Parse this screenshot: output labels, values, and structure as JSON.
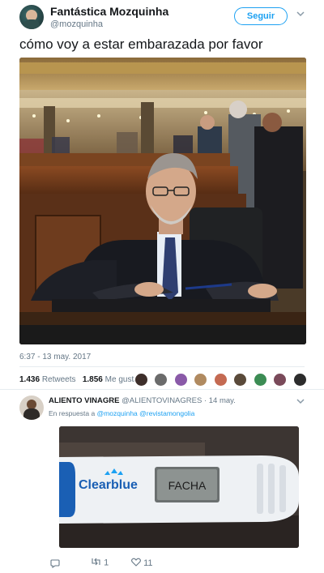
{
  "tweet": {
    "author_name": "Fantástica Mozquinha",
    "author_handle": "@mozquinha",
    "follow_label": "Seguir",
    "text": "cómo voy a estar embarazada por favor",
    "timestamp": "6:37 - 13 may. 2017",
    "retweets_count": "1.436",
    "retweets_label": "Retweets",
    "likes_count": "1.856",
    "likes_label": "Me gusta"
  },
  "reply": {
    "author_name": "ALIENTO VINAGRE",
    "author_handle": "@ALIENTOVINAGRES",
    "separator": " · ",
    "date": "14 may.",
    "reply_to_prefix": "En respuesta a",
    "reply_to_1": "@mozquinha",
    "reply_to_2": "@revistamongolia",
    "image_brand": "Clearblue",
    "image_result": "FACHA",
    "retweet_count": "1",
    "like_count": "11"
  },
  "colors": {
    "accent": "#1da1f2",
    "muted": "#657786",
    "heart": "#e0245e"
  },
  "icons": [
    "chevron-down-icon",
    "reply-icon",
    "retweet-icon",
    "heart-icon"
  ]
}
